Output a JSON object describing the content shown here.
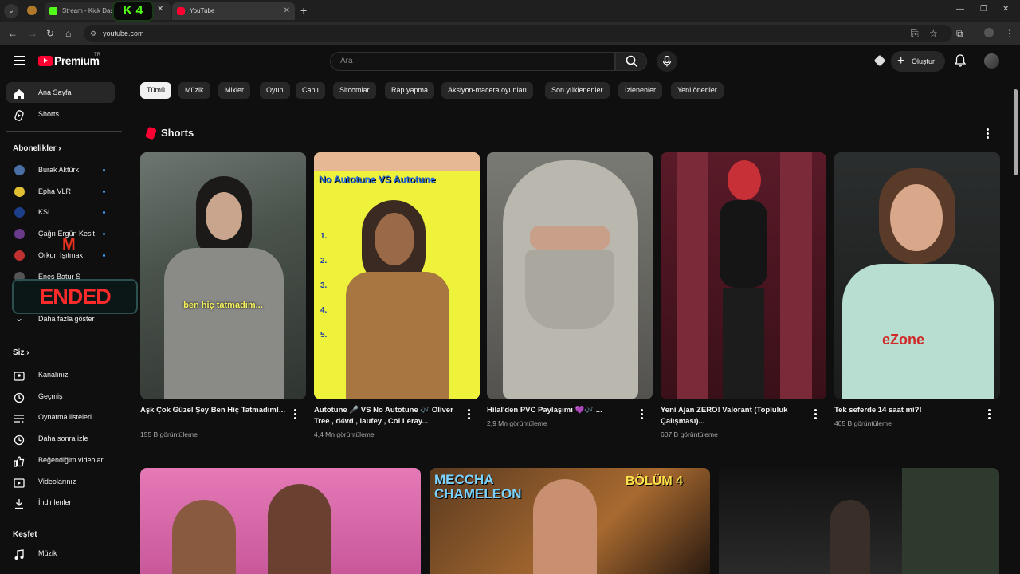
{
  "browser": {
    "tabs": [
      {
        "title": "Stream - Kick Dast",
        "favicon": "kick-icon"
      },
      {
        "title": "YouTube",
        "favicon": "youtube-icon"
      }
    ],
    "kick_badge": "K 4",
    "url": "youtube.com"
  },
  "header": {
    "logo_text": "Premium",
    "logo_region": "TR",
    "search_placeholder": "Ara",
    "create_label": "Oluştur"
  },
  "sidebar": {
    "main": [
      {
        "label": "Ana Sayfa",
        "icon": "home-icon"
      },
      {
        "label": "Shorts",
        "icon": "shorts-icon"
      }
    ],
    "subscriptions_heading": "Abonelikler",
    "subscriptions": [
      {
        "label": "Burak Aktürk",
        "color": "#4a6fa5"
      },
      {
        "label": "Epha VLR",
        "color": "#e0c030"
      },
      {
        "label": "KSI",
        "color": "#1d3f8a"
      },
      {
        "label": "Çağrı Ergün Kesit",
        "color": "#6a3a8a"
      },
      {
        "label": "Orkun Işıtmak",
        "color": "#c03030"
      },
      {
        "label": "Enes Batur S",
        "color": "#555555"
      }
    ],
    "show_more": "Daha fazla göster",
    "you_heading": "Siz",
    "you_items": [
      {
        "label": "Kanalınız",
        "icon": "channel-icon"
      },
      {
        "label": "Geçmiş",
        "icon": "history-icon"
      },
      {
        "label": "Oynatma listeleri",
        "icon": "playlist-icon"
      },
      {
        "label": "Daha sonra izle",
        "icon": "watch-later-icon"
      },
      {
        "label": "Beğendiğim videolar",
        "icon": "like-icon"
      },
      {
        "label": "Videolarınız",
        "icon": "your-videos-icon"
      },
      {
        "label": "İndirilenler",
        "icon": "download-icon"
      }
    ],
    "explore_heading": "Keşfet",
    "explore_items": [
      {
        "label": "Müzik",
        "icon": "music-icon"
      }
    ],
    "overlay_ended": "ENDED"
  },
  "chips": [
    "Tümü",
    "Müzik",
    "Mixler",
    "Oyun",
    "Canlı",
    "Sitcomlar",
    "Rap yapma",
    "Aksiyon-macera oyunları",
    "Son yüklenenler",
    "İzlenenler",
    "Yeni öneriler"
  ],
  "shorts": {
    "heading": "Shorts",
    "items": [
      {
        "title": "Aşk Çok Güzel Şey Ben Hiç Tatmadım!...",
        "views": "155 B görüntüleme",
        "caption": "ben hiç tatmadım..."
      },
      {
        "title": "Autotune 🎤 VS No Autotune 🎶 Oliver Tree , d4vd , laufey , Coi Leray...",
        "views": "4,4 Mn görüntüleme",
        "caption": "No Autotune VS Autotune"
      },
      {
        "title": "Hilal'den PVC Paylaşımı 💜🎶 ...",
        "views": "2,9 Mn görüntüleme",
        "caption": ""
      },
      {
        "title": "Yeni Ajan ZERO! Valorant (Topluluk Çalışması)...",
        "views": "607 B görüntüleme",
        "caption": ""
      },
      {
        "title": "Tek seferde 14 saat mi?!",
        "views": "405 B görüntüleme",
        "caption": "eZone"
      }
    ]
  },
  "videos": [
    {
      "thumb_text": ""
    },
    {
      "thumb_text": "MECCHA CHAMELEON",
      "thumb_text2": "BÖLÜM 4"
    },
    {
      "thumb_text": ""
    }
  ]
}
